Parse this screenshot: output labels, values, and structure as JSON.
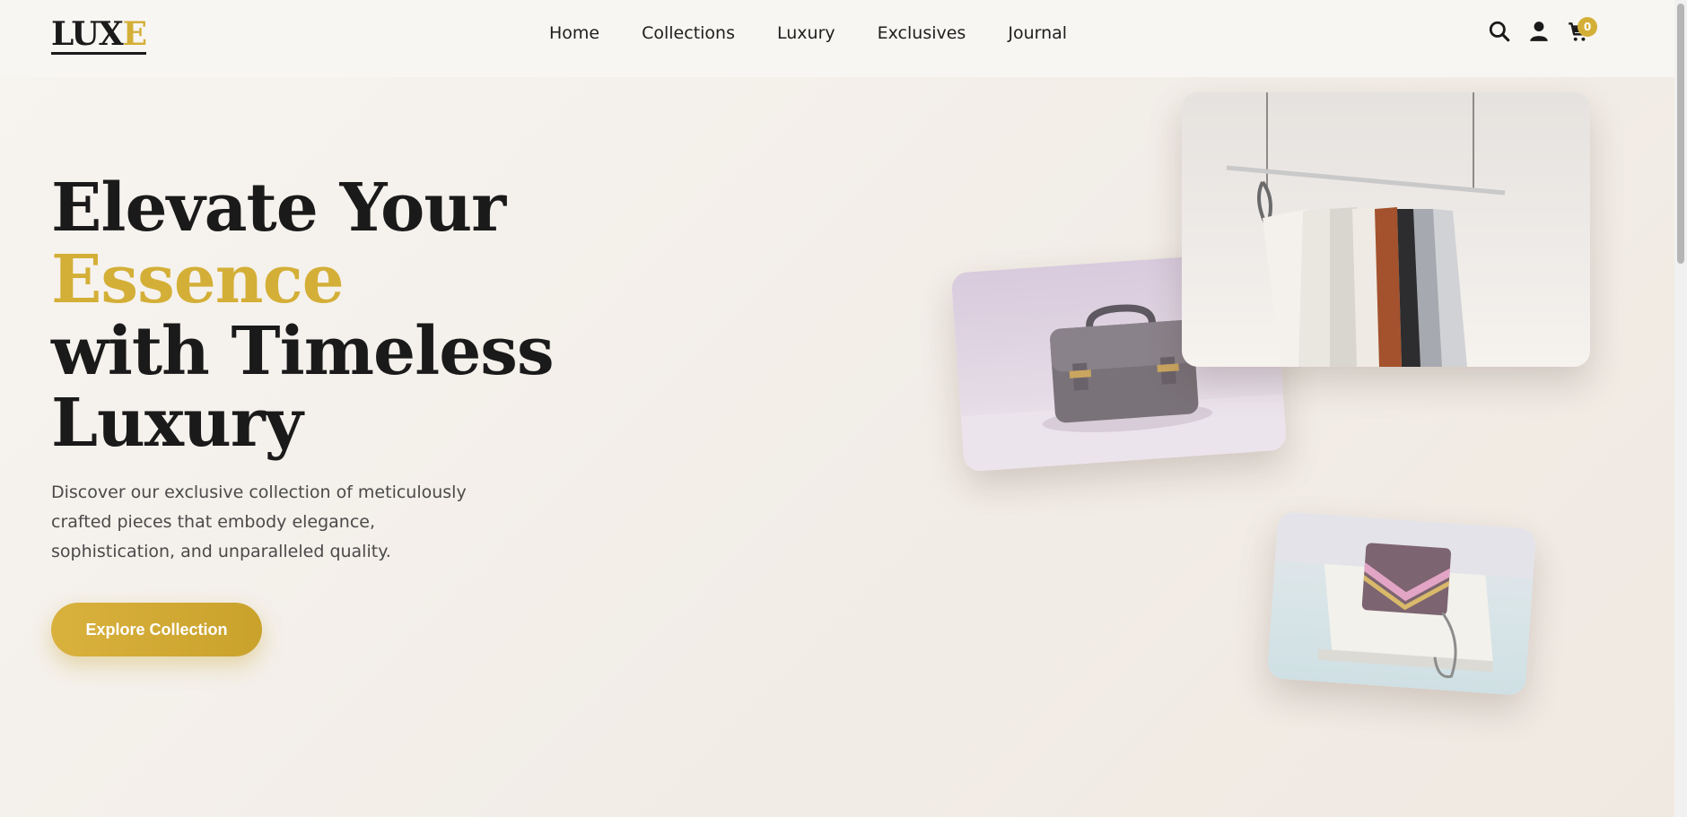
{
  "header": {
    "logo_main": "LUX",
    "logo_accent": "E",
    "nav": [
      "Home",
      "Collections",
      "Luxury",
      "Exclusives",
      "Journal"
    ],
    "cart_count": "0"
  },
  "hero": {
    "title_line1": "Elevate Your",
    "title_line2": "Essence",
    "title_line3": "with Timeless",
    "title_line4": "Luxury",
    "description": "Discover our exclusive collection of meticulously crafted pieces that embody elegance, sophistication, and unparalleled quality.",
    "cta_label": "Explore Collection"
  },
  "colors": {
    "accent": "#d4af37",
    "text": "#1a1a1a",
    "background": "#f5f1ec"
  },
  "icons": [
    "search-icon",
    "user-icon",
    "cart-icon"
  ]
}
